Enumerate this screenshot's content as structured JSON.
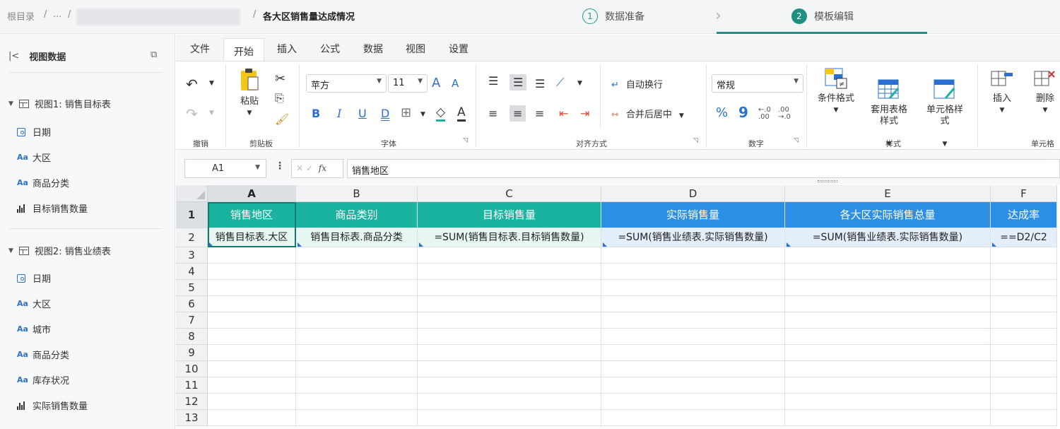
{
  "breadcrumb": {
    "root": "根目录",
    "sep1": "/",
    "ellipsis": "...",
    "sep2": "/",
    "sep3": "/",
    "current": "各大区销售量达成情况"
  },
  "steps": [
    {
      "num": "1",
      "label": "数据准备"
    },
    {
      "num": "2",
      "label": "模板编辑"
    }
  ],
  "step_arrow": "›",
  "sidebar": {
    "title": "视图数据",
    "collapse_icon": "|<",
    "copy_icon": "⧉",
    "view1": {
      "name": "视图1: 销售目标表",
      "fields": [
        {
          "type": "date",
          "label": "日期"
        },
        {
          "type": "text",
          "icon": "Aa",
          "label": "大区"
        },
        {
          "type": "text",
          "icon": "Aa",
          "label": "商品分类"
        },
        {
          "type": "measure",
          "label": "目标销售数量"
        }
      ]
    },
    "view2": {
      "name": "视图2: 销售业绩表",
      "fields": [
        {
          "type": "date",
          "label": "日期"
        },
        {
          "type": "text",
          "icon": "Aa",
          "label": "大区"
        },
        {
          "type": "text",
          "icon": "Aa",
          "label": "城市"
        },
        {
          "type": "text",
          "icon": "Aa",
          "label": "商品分类"
        },
        {
          "type": "text",
          "icon": "Aa",
          "label": "库存状况"
        },
        {
          "type": "measure",
          "label": "实际销售数量"
        }
      ]
    }
  },
  "ribbon": {
    "tabs": [
      "文件",
      "开始",
      "插入",
      "公式",
      "数据",
      "视图",
      "设置"
    ],
    "active_tab": "开始",
    "undo_group": "撤销",
    "clipboard": {
      "paste": "粘贴",
      "group": "剪贴板"
    },
    "font": {
      "name": "苹方",
      "size": "11",
      "group": "字体",
      "bold": "B",
      "italic": "I",
      "underline": "U",
      "dunderline": "D",
      "grow": "A",
      "shrink": "A",
      "color": "A"
    },
    "align": {
      "wrap": "自动换行",
      "merge": "合并后居中",
      "group": "对齐方式"
    },
    "number": {
      "format": "常规",
      "group": "数字",
      "percent": "%",
      "comma": "9",
      "inc": "←.0 .00",
      "dec": ".00 →.0"
    },
    "styles": {
      "cond": "条件格式",
      "table": "套用表格\n样式",
      "cell": "单元格样\n式",
      "group": "样式"
    },
    "cells": {
      "insert": "插入",
      "delete": "删除",
      "group": "单元格"
    }
  },
  "formula_bar": {
    "name_box": "A1",
    "cancel": "✕",
    "confirm": "✓",
    "fx": "fx",
    "value": "销售地区"
  },
  "grid": {
    "columns": [
      "A",
      "B",
      "C",
      "D",
      "E",
      "F"
    ],
    "rows": [
      "1",
      "2",
      "3",
      "4",
      "5",
      "6",
      "7",
      "8",
      "9",
      "10",
      "11",
      "12",
      "13"
    ],
    "header_row": [
      "销售地区",
      "商品类别",
      "目标销售量",
      "实际销售量",
      "各大区实际销售总量",
      "达成率"
    ],
    "data_row": [
      "销售目标表.大区",
      "销售目标表.商品分类",
      "=SUM(销售目标表.目标销售数量)",
      "=SUM(销售业绩表.实际销售数量)",
      "=SUM(销售业绩表.实际销售数量)",
      "==D2/C2"
    ]
  },
  "colors": {
    "accent": "#1f8f82",
    "header_green": "#1ab39f",
    "header_blue": "#2b8fe6"
  }
}
